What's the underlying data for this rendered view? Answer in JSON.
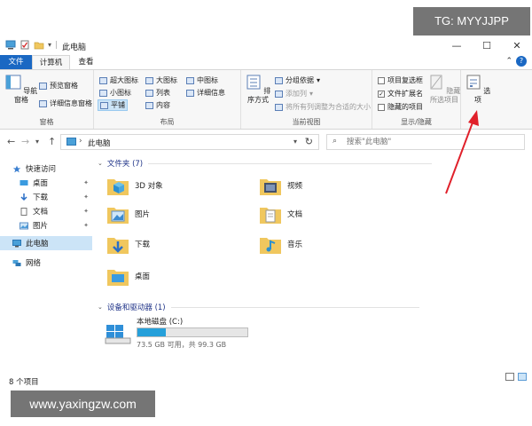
{
  "watermarks": {
    "tg": "TG: MYYJJPP",
    "url": "www.yaxingzw.com"
  },
  "window": {
    "title": "此电脑"
  },
  "tabs": {
    "file": "文件",
    "computer": "计算机",
    "view": "查看"
  },
  "ribbon": {
    "panes": {
      "nav_pane": "导航窗格",
      "preview_pane": "预览窗格",
      "details_pane": "详细信息窗格",
      "label": "窗格"
    },
    "layout": {
      "extra_large_icons": "超大图标",
      "large_icons": "大图标",
      "medium_icons": "中图标",
      "small_icons": "小图标",
      "list": "列表",
      "details": "详细信息",
      "tiles": "平铺",
      "content": "内容",
      "label": "布局"
    },
    "current_view": {
      "sort_by": "排序方式",
      "group_by": "分组依据",
      "add_columns": "添加列",
      "size_all_columns": "将所有列调整为合适的大小",
      "label": "当前视图"
    },
    "show_hide": {
      "item_checkboxes": "项目复选框",
      "file_extensions": "文件扩展名",
      "hidden_items": "隐藏的项目",
      "hide_selected": "隐藏",
      "hide_selected_line2": "所选项目",
      "label": "显示/隐藏",
      "file_extensions_checked": true
    },
    "options": "选项"
  },
  "address": {
    "path": "此电脑",
    "search_placeholder": "搜索\"此电脑\""
  },
  "nav": {
    "quick_access": "快速访问",
    "desktop": "桌面",
    "downloads": "下载",
    "documents": "文档",
    "pictures": "图片",
    "this_pc": "此电脑",
    "network": "网络"
  },
  "folders": {
    "header": "文件夹 (7)",
    "items": [
      "3D 对象",
      "视频",
      "图片",
      "文档",
      "下载",
      "音乐",
      "桌面"
    ]
  },
  "devices": {
    "header": "设备和驱动器 (1)",
    "drive_name": "本地磁盘 (C:)",
    "drive_info": "73.5 GB 可用，共 99.3 GB",
    "free_gb": 73.5,
    "total_gb": 99.3
  },
  "status": {
    "count": "8 个项目"
  },
  "colors": {
    "accent": "#1a68c3",
    "selection": "#cce4f7",
    "drive_bar": "#26a0da",
    "arrow": "#e0202a",
    "folder": "#f0c75e"
  }
}
